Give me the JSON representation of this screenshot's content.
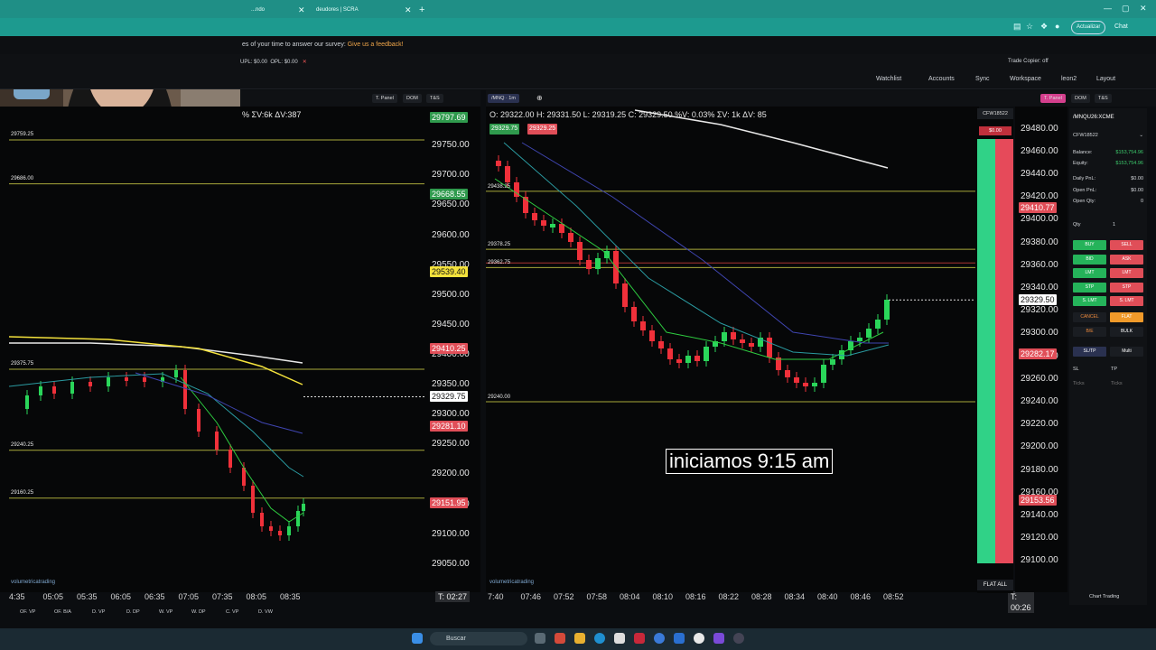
{
  "browser": {
    "tab1_label": "...ndo",
    "tab2_label": "deudores | SCRA",
    "update_label": "Actualizar",
    "chat_label": "Chat"
  },
  "survey": {
    "text": "es of your time to answer our survey:",
    "link": "Give us a feedback!"
  },
  "appbar": {
    "upl": "UPL: $0.00",
    "opl": "OPL: $0.00",
    "trade_copier": "Trade Copier: off"
  },
  "toolbar": {
    "watchlist": "Watchlist",
    "accounts": "Accounts",
    "sync": "Sync",
    "workspace": "Workspace",
    "user": "leon2",
    "layout": "Layout"
  },
  "left_chart": {
    "buttons": [
      "T. Panel",
      "DOM",
      "T&S"
    ],
    "ohlc": "% ΣV:6k  ΔV:387",
    "levels": [
      {
        "label": "29759.25",
        "price": 29759.25
      },
      {
        "label": "29686.00",
        "price": 29686.0
      },
      {
        "label": "29375.75",
        "price": 29375.75
      },
      {
        "label": "29240.25",
        "price": 29240.25
      },
      {
        "label": "29160.25",
        "price": 29160.25
      }
    ],
    "price_scale": [
      "29750.00",
      "29700.00",
      "29650.00",
      "29600.00",
      "29550.00",
      "29500.00",
      "29450.00",
      "29400.00",
      "29350.00",
      "29300.00",
      "29250.00",
      "29200.00",
      "29150.00",
      "29100.00",
      "29050.00"
    ],
    "tags": [
      {
        "text": "29797.69",
        "price": 29797.69,
        "bg": "#2f9a4d",
        "fg": "#ffffff"
      },
      {
        "text": "29668.55",
        "price": 29668.55,
        "bg": "#2f9a4d",
        "fg": "#ffffff"
      },
      {
        "text": "29539.40",
        "price": 29539.4,
        "bg": "#f4e23c",
        "fg": "#111111"
      },
      {
        "text": "29410.25",
        "price": 29410.25,
        "bg": "#e04e58",
        "fg": "#ffffff"
      },
      {
        "text": "29329.75",
        "price": 29329.75,
        "bg": "#ffffff",
        "fg": "#111111"
      },
      {
        "text": "29281.10",
        "price": 29281.1,
        "bg": "#e04e58",
        "fg": "#ffffff"
      },
      {
        "text": "29151.95",
        "price": 29151.95,
        "bg": "#e04e58",
        "fg": "#ffffff"
      }
    ],
    "times": [
      "4:35",
      "05:05",
      "05:35",
      "06:05",
      "06:35",
      "07:05",
      "07:35",
      "08:05",
      "08:35"
    ],
    "timer": "T: 02:27",
    "bottom_tabs": [
      "OF. VP",
      "OF. B/A",
      "D. VP",
      "D. DP",
      "W. VP",
      "W. DP",
      "C. VP",
      "D. VW"
    ],
    "watermark": "volumetricatrading"
  },
  "right_chart": {
    "symbol": "/MNQ",
    "interval": "1m",
    "buttons": [
      "T. Panel",
      "DOM",
      "T&S"
    ],
    "ohlc": "O: 29322.00  H: 29331.50  L: 29319.25  C: 29329.50  %V: 0.03%  ΣV: 1k  ΔV: 85",
    "bid_tag": "29329.75",
    "ask_tag": "29329.25",
    "levels": [
      {
        "label": "29438.25",
        "price": 29425.0
      },
      {
        "label": "29378.25",
        "price": 29374.0
      },
      {
        "label": "29362.75",
        "price": 29358.0
      },
      {
        "label": "29240.00",
        "price": 29240.0
      }
    ],
    "price_scale": [
      "29480.00",
      "29460.00",
      "29440.00",
      "29420.00",
      "29400.00",
      "29380.00",
      "29360.00",
      "29340.00",
      "29320.00",
      "29300.00",
      "29280.00",
      "29260.00",
      "29240.00",
      "29220.00",
      "29200.00",
      "29180.00",
      "29160.00",
      "29140.00",
      "29120.00",
      "29100.00"
    ],
    "tags": [
      {
        "text": "29410.77",
        "price": 29410.77,
        "bg": "#e04e58",
        "fg": "#ffffff"
      },
      {
        "text": "29329.50",
        "price": 29329.5,
        "bg": "#ffffff",
        "fg": "#111111"
      },
      {
        "text": "29282.17",
        "price": 29282.17,
        "bg": "#e04e58",
        "fg": "#ffffff"
      },
      {
        "text": "29153.56",
        "price": 29153.56,
        "bg": "#e04e58",
        "fg": "#ffffff"
      }
    ],
    "times": [
      "7:40",
      "07:46",
      "07:52",
      "07:58",
      "08:04",
      "08:10",
      "08:16",
      "08:22",
      "08:28",
      "08:34",
      "08:40",
      "08:46",
      "08:52"
    ],
    "timer": "T: 00:26",
    "bottom_tabs": [
      "OF. VP",
      "OF. B/A",
      "D. VP",
      "D. DP",
      "W. VP",
      "W. DP",
      "C. VP",
      "D. VW"
    ],
    "watermark": "volumetricatrading",
    "subtitle": "iniciamos 9:15 am"
  },
  "dom": {
    "account": "CFW18522",
    "pnl": "$0.00",
    "flat_all": "FLAT ALL"
  },
  "trade_panel": {
    "symbol": "/MNQU26:XCME",
    "account": "CFW18522",
    "rows": [
      {
        "label": "Balance:",
        "value": "$153,754.96",
        "color": "#3cc96b"
      },
      {
        "label": "Equity:",
        "value": "$153,754.96",
        "color": "#3cc96b"
      },
      {
        "label": "Daily PnL:",
        "value": "$0.00",
        "color": "#d6d9dd"
      },
      {
        "label": "Open PnL:",
        "value": "$0.00",
        "color": "#d6d9dd"
      },
      {
        "label": "Open Qty:",
        "value": "0",
        "color": "#d6d9dd"
      }
    ],
    "qty_label": "Qty",
    "qty_value": "1",
    "buttons": [
      [
        "BUY",
        "SELL"
      ],
      [
        "BID",
        "ASK"
      ],
      [
        "LMT",
        "LMT"
      ],
      [
        "STP",
        "STP"
      ],
      [
        "S. LMT",
        "S. LMT"
      ]
    ],
    "cancel": "CANCEL",
    "flat": "FLAT",
    "be": "B/E",
    "bulk": "BULK",
    "sltp": "SL/TP",
    "multi": "Multi",
    "sl": "SL",
    "tp": "TP",
    "ticks": "Ticks",
    "footer": "Chart Trading"
  },
  "taskbar": {
    "search_placeholder": "Buscar"
  },
  "colors": {
    "up": "#2ad65a",
    "down": "#f0303a",
    "ema_fast": "#2ecc40",
    "ema_slow": "#2a9aa0",
    "vwap": "#3f45b0",
    "level": "#a8a83a"
  }
}
